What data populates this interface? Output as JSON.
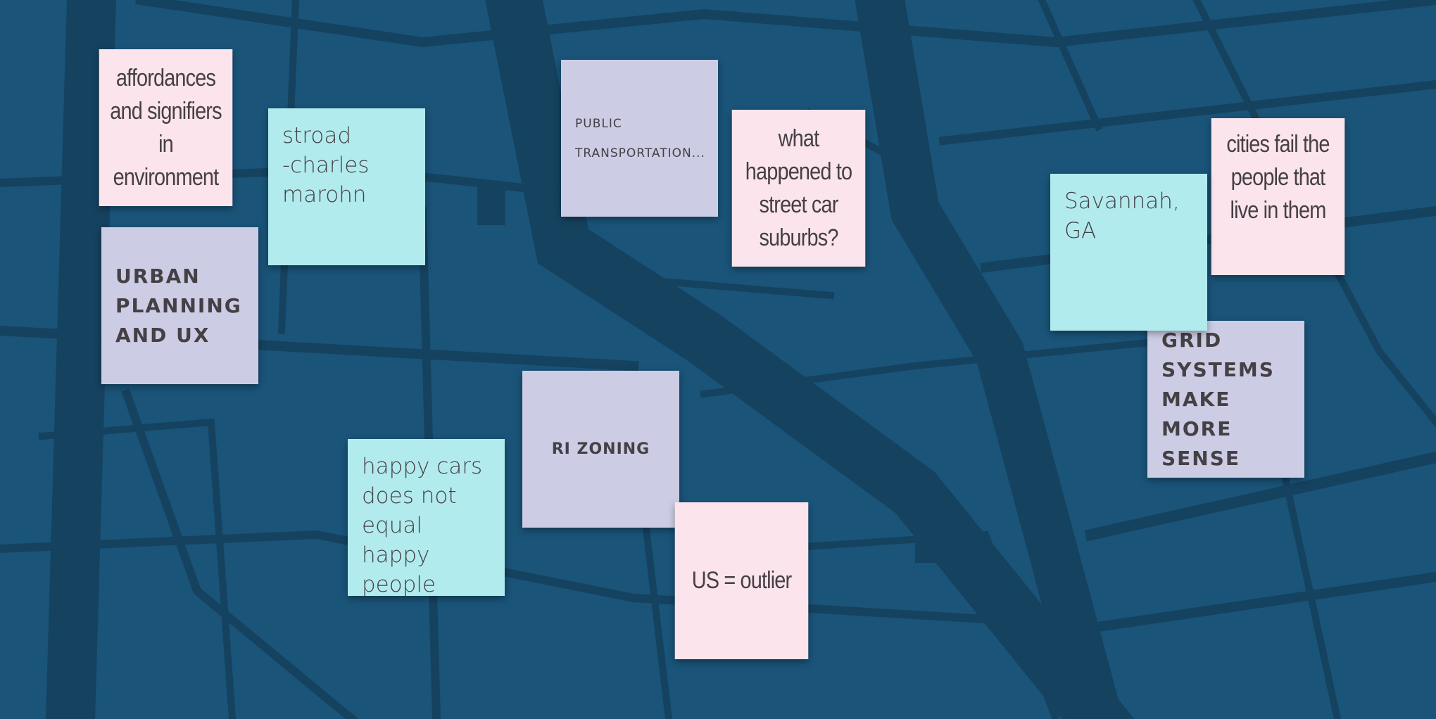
{
  "board": {
    "background_color": "#1a5479",
    "road_color": "#15425f",
    "notes": [
      {
        "text": "affordances and signifiers in environment",
        "color": "pink"
      },
      {
        "text": "stroad\n-charles marohn",
        "color": "cyan"
      },
      {
        "text": "URBAN\nPLANNING\nAND UX",
        "color": "lavender"
      },
      {
        "text": "PUBLIC\nTRANSPORTATION...",
        "color": "lavender"
      },
      {
        "text": "what happened to street car suburbs?",
        "color": "pink"
      },
      {
        "text": "Savannah, GA",
        "color": "cyan"
      },
      {
        "text": "cities fail the people that live in them",
        "color": "pink"
      },
      {
        "text": "GRID\nSYSTEMS\nMAKE MORE\nSENSE",
        "color": "lavender"
      },
      {
        "text": "RI ZONING",
        "color": "lavender"
      },
      {
        "text": "happy cars\ndoes not equal\nhappy people",
        "color": "cyan"
      },
      {
        "text": "US = outlier",
        "color": "pink"
      }
    ],
    "note_colors": {
      "pink": "#fce4ec",
      "cyan": "#b2ebee",
      "lavender": "#cccde5"
    }
  }
}
